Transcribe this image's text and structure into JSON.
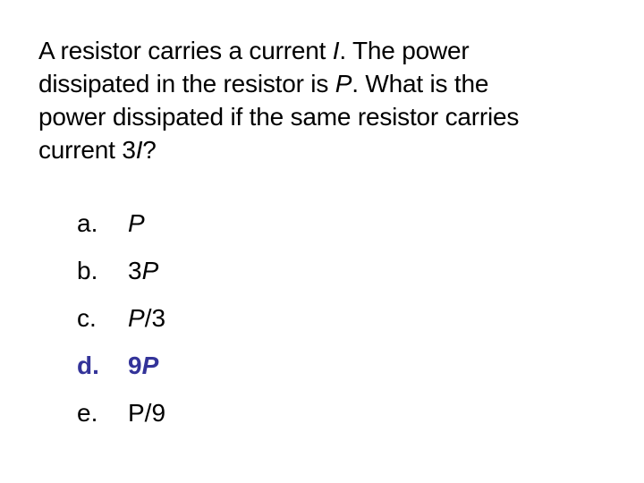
{
  "question": {
    "line1_a": "A resistor carries a current ",
    "line1_var": "I",
    "line1_b": ".  The power",
    "line2_a": "dissipated in the resistor is ",
    "line2_var": "P",
    "line2_b": ".  What is the",
    "line3": "power dissipated if the same resistor carries",
    "line4_a": "current 3",
    "line4_var": "I",
    "line4_b": "?"
  },
  "options": [
    {
      "letter": "a.",
      "pre": "",
      "var": "P",
      "post": ""
    },
    {
      "letter": "b.",
      "pre": "3",
      "var": "P",
      "post": ""
    },
    {
      "letter": "c.",
      "pre": "",
      "var": "P",
      "post": "/3"
    },
    {
      "letter": "d.",
      "pre": "9",
      "var": "P",
      "post": "",
      "highlighted": true
    },
    {
      "letter": "e.",
      "pre": "P/9",
      "var": "",
      "post": ""
    }
  ],
  "colors": {
    "highlight": "#333399",
    "text": "#000000"
  }
}
